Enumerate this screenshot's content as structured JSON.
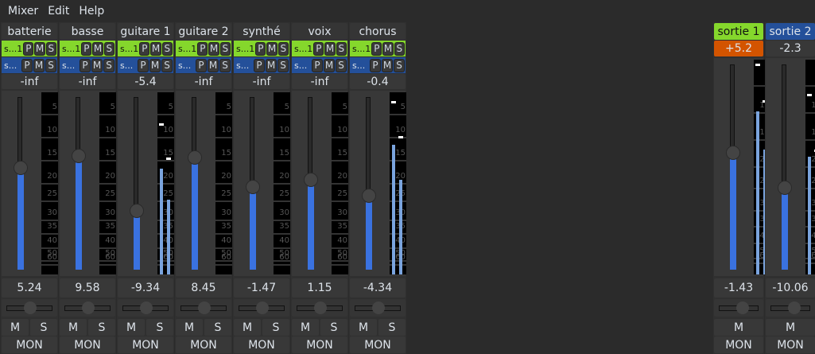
{
  "menu": [
    "Mixer",
    "Edit",
    "Help"
  ],
  "colors": {
    "send_green": "#85d72c",
    "return_blue": "#24509a",
    "clip_orange": "#d35400",
    "fader_blue": "#3a72e0",
    "meter_blue": "#7aa4de"
  },
  "meter_scale": [
    "5",
    "10",
    "15",
    "20",
    "25",
    "30",
    "35",
    "40",
    "50",
    "60"
  ],
  "strips": [
    {
      "name": "batterie",
      "send": "s...1",
      "ret": "s...",
      "p": "P",
      "m": "M",
      "s": "S",
      "peak": "-inf",
      "gain": "5.24",
      "fader": 0.59,
      "meters": [
        0,
        0
      ],
      "peaks": [
        null,
        null
      ],
      "mute": "M",
      "solo": "S",
      "mon": "MON"
    },
    {
      "name": "basse",
      "send": "s...1",
      "ret": "s...",
      "p": "P",
      "m": "M",
      "s": "S",
      "peak": "-inf",
      "gain": "9.58",
      "fader": 0.66,
      "meters": [
        0,
        0
      ],
      "peaks": [
        null,
        null
      ],
      "mute": "M",
      "solo": "S",
      "mon": "MON"
    },
    {
      "name": "guitare 1",
      "send": "s...1",
      "ret": "s...",
      "p": "P",
      "m": "M",
      "s": "S",
      "peak": "-5.4",
      "gain": "-9.34",
      "fader": 0.34,
      "meters": [
        0.58,
        0.41
      ],
      "peaks": [
        0.83,
        0.64
      ],
      "mute": "M",
      "solo": "S",
      "mon": "MON"
    },
    {
      "name": "guitare 2",
      "send": "s...1",
      "ret": "s...",
      "p": "P",
      "m": "M",
      "s": "S",
      "peak": "-inf",
      "gain": "8.45",
      "fader": 0.65,
      "meters": [
        0,
        0
      ],
      "peaks": [
        null,
        null
      ],
      "mute": "M",
      "solo": "S",
      "mon": "MON"
    },
    {
      "name": "synthé",
      "send": "s...1",
      "ret": "s...",
      "p": "P",
      "m": "M",
      "s": "S",
      "peak": "-inf",
      "gain": "-1.47",
      "fader": 0.48,
      "meters": [
        0,
        0
      ],
      "peaks": [
        null,
        null
      ],
      "mute": "M",
      "solo": "S",
      "mon": "MON"
    },
    {
      "name": "voix",
      "send": "s...1",
      "ret": "s...",
      "p": "P",
      "m": "M",
      "s": "S",
      "peak": "-inf",
      "gain": "1.15",
      "fader": 0.52,
      "meters": [
        0,
        0
      ],
      "peaks": [
        null,
        null
      ],
      "mute": "M",
      "solo": "S",
      "mon": "MON"
    },
    {
      "name": "chorus",
      "send": "s...1",
      "ret": "s...",
      "p": "P",
      "m": "M",
      "s": "S",
      "peak": "-0.4",
      "gain": "-4.34",
      "fader": 0.43,
      "meters": [
        0.71,
        0.52
      ],
      "peaks": [
        0.95,
        0.76
      ],
      "mute": "M",
      "solo": "S",
      "mon": "MON"
    }
  ],
  "outputs": [
    {
      "name": "sortie 1",
      "peak": "+5.2",
      "peak_clip": true,
      "gain": "-1.43",
      "fader": 0.57,
      "meters": [
        0.76,
        0.58
      ],
      "peaks": [
        0.98,
        0.81
      ],
      "mute": "M",
      "mon": "MON"
    },
    {
      "name": "sortie 2",
      "peak": "-2.3",
      "peak_clip": false,
      "gain": "-10.06",
      "fader": 0.4,
      "meters": [
        0.55,
        0.4
      ],
      "peaks": [
        0.84,
        0.58
      ],
      "mute": "M",
      "mon": "MON"
    }
  ]
}
